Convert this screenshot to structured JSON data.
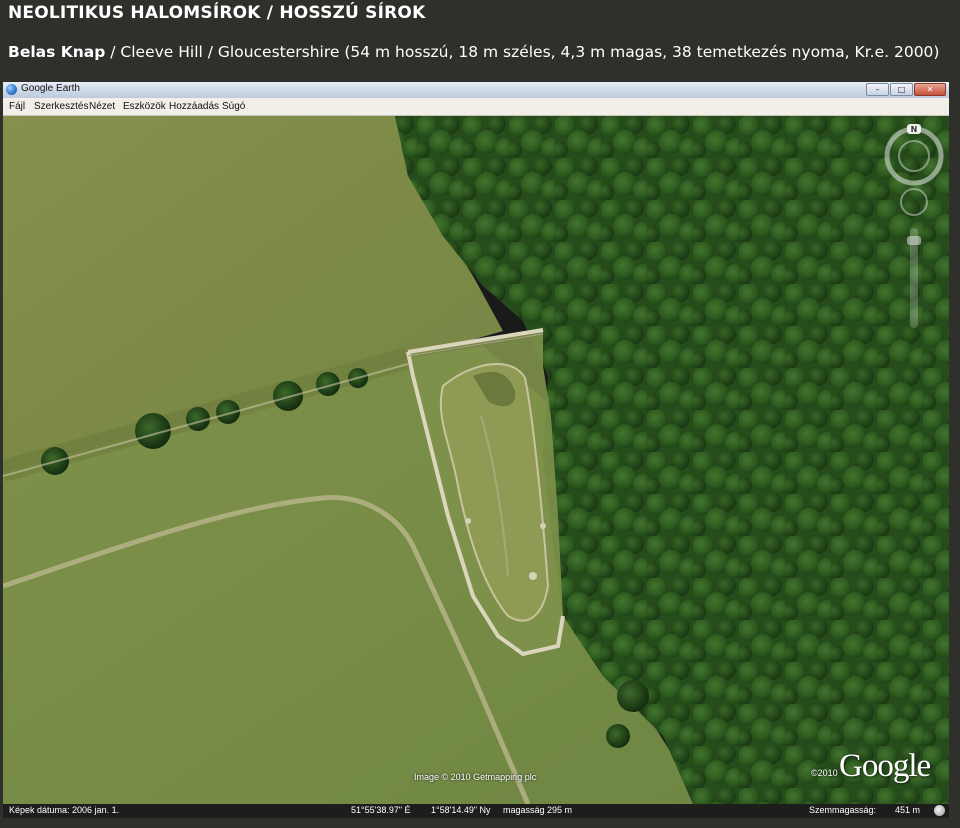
{
  "slide": {
    "title": "NEOLITIKUS HALOMSÍROK / HOSSZÚ SÍROK",
    "subtitle_bold": "Belas Knap",
    "subtitle_rest": " / Cleeve Hill / Gloucestershire (54 m hosszú, 18 m széles, 4,3 m magas, 38 temetkezés nyoma, Kr.e. 2000)"
  },
  "window": {
    "title": "Google Earth",
    "buttons": {
      "minimize": "–",
      "maximize": "□",
      "close": "✕"
    },
    "icons": {
      "app": "google-earth-icon"
    }
  },
  "menu": [
    {
      "label": "Fájl"
    },
    {
      "label": "Szerkesztés"
    },
    {
      "label": "Nézet"
    },
    {
      "label": "Eszközök"
    },
    {
      "label": "Hozzáadás"
    },
    {
      "label": "Súgó"
    }
  ],
  "navigation": {
    "north_label": "N",
    "icons": {
      "compass": "compass-ring-icon",
      "look": "look-joystick-icon",
      "zoom": "zoom-slider-icon"
    }
  },
  "map": {
    "attribution": "Image © 2010 Getmapping plc",
    "copyright_year": "©2010",
    "brand": "Google",
    "colors": {
      "field": "#7d8a45",
      "forest": "#2f5a20",
      "wall": "#d9d2bd"
    }
  },
  "status": {
    "imagery_date": "Képek dátuma: 2006 jan. 1.",
    "latitude": "51°55'38.97\" É",
    "longitude": "1°58'14.49\" Ny",
    "elevation": "magasság 295 m",
    "eye_alt_label": "Szemmagasság:",
    "eye_alt_value": "451 m"
  }
}
